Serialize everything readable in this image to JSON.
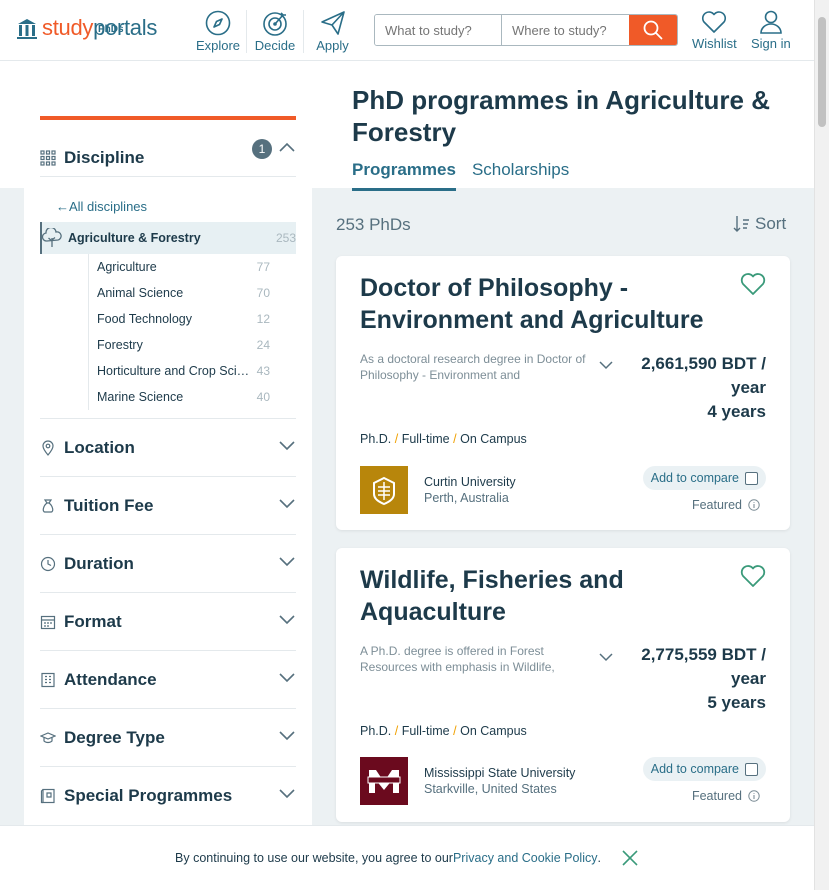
{
  "header": {
    "logo_part1": "study",
    "logo_part2": "portals",
    "logo_sub": "PhDs",
    "nav": [
      {
        "label": "Explore",
        "icon": "compass-icon"
      },
      {
        "label": "Decide",
        "icon": "target-icon"
      },
      {
        "label": "Apply",
        "icon": "paper-plane-icon"
      }
    ],
    "search": {
      "what_placeholder": "What to study?",
      "where_placeholder": "Where to study?"
    },
    "wishlist_label": "Wishlist",
    "signin_label": "Sign in"
  },
  "sidebar": {
    "discipline_label": "Discipline",
    "discipline_badge": "1",
    "all_disciplines": "All disciplines",
    "current": {
      "name": "Agriculture & Forestry",
      "count": "253"
    },
    "subdisciplines": [
      {
        "name": "Agriculture",
        "count": "77"
      },
      {
        "name": "Animal Science",
        "count": "70"
      },
      {
        "name": "Food Technology",
        "count": "12"
      },
      {
        "name": "Forestry",
        "count": "24"
      },
      {
        "name": "Horticulture and Crop Science",
        "count": "43"
      },
      {
        "name": "Marine Science",
        "count": "40"
      }
    ],
    "filters": [
      {
        "label": "Location",
        "icon": "pin-icon"
      },
      {
        "label": "Tuition Fee",
        "icon": "moneybag-icon"
      },
      {
        "label": "Duration",
        "icon": "clock-icon"
      },
      {
        "label": "Format",
        "icon": "calendar-icon"
      },
      {
        "label": "Attendance",
        "icon": "building-icon"
      },
      {
        "label": "Degree Type",
        "icon": "graduation-cap-icon"
      },
      {
        "label": "Special Programmes",
        "icon": "book-icon"
      }
    ]
  },
  "main": {
    "title": "PhD programmes in Agriculture & Forestry",
    "tabs": [
      {
        "label": "Programmes",
        "active": true
      },
      {
        "label": "Scholarships",
        "active": false
      }
    ],
    "result_count": "253 PhDs",
    "sort_label": "Sort",
    "cards": [
      {
        "title": "Doctor of Philosophy - Environment and Agriculture",
        "description": "As a doctoral research degree in Doctor of Philosophy - Environment and",
        "fee_line1": "2,661,590 BDT /",
        "fee_line2": "year",
        "duration": "4 years",
        "degree": "Ph.D.",
        "pace": "Full-time",
        "attendance": "On Campus",
        "university": "Curtin University",
        "location": "Perth, Australia",
        "compare_label": "Add to compare",
        "featured_label": "Featured",
        "logo_color": "#b8860b"
      },
      {
        "title": "Wildlife, Fisheries and Aquaculture",
        "description": "A Ph.D. degree is offered in Forest Resources with emphasis in Wildlife,",
        "fee_line1": "2,775,559 BDT /",
        "fee_line2": "year",
        "duration": "5 years",
        "degree": "Ph.D.",
        "pace": "Full-time",
        "attendance": "On Campus",
        "university": "Mississippi State University",
        "location": "Starkville, United States",
        "compare_label": "Add to compare",
        "featured_label": "Featured",
        "logo_color": "#6b0a1e"
      }
    ]
  },
  "cookie": {
    "text": "By continuing to use our website, you agree to our ",
    "link": "Privacy and Cookie Policy",
    "end": "."
  },
  "colors": {
    "accent": "#f05a28",
    "primary": "#2a6e88",
    "text": "#1d3a4a"
  }
}
